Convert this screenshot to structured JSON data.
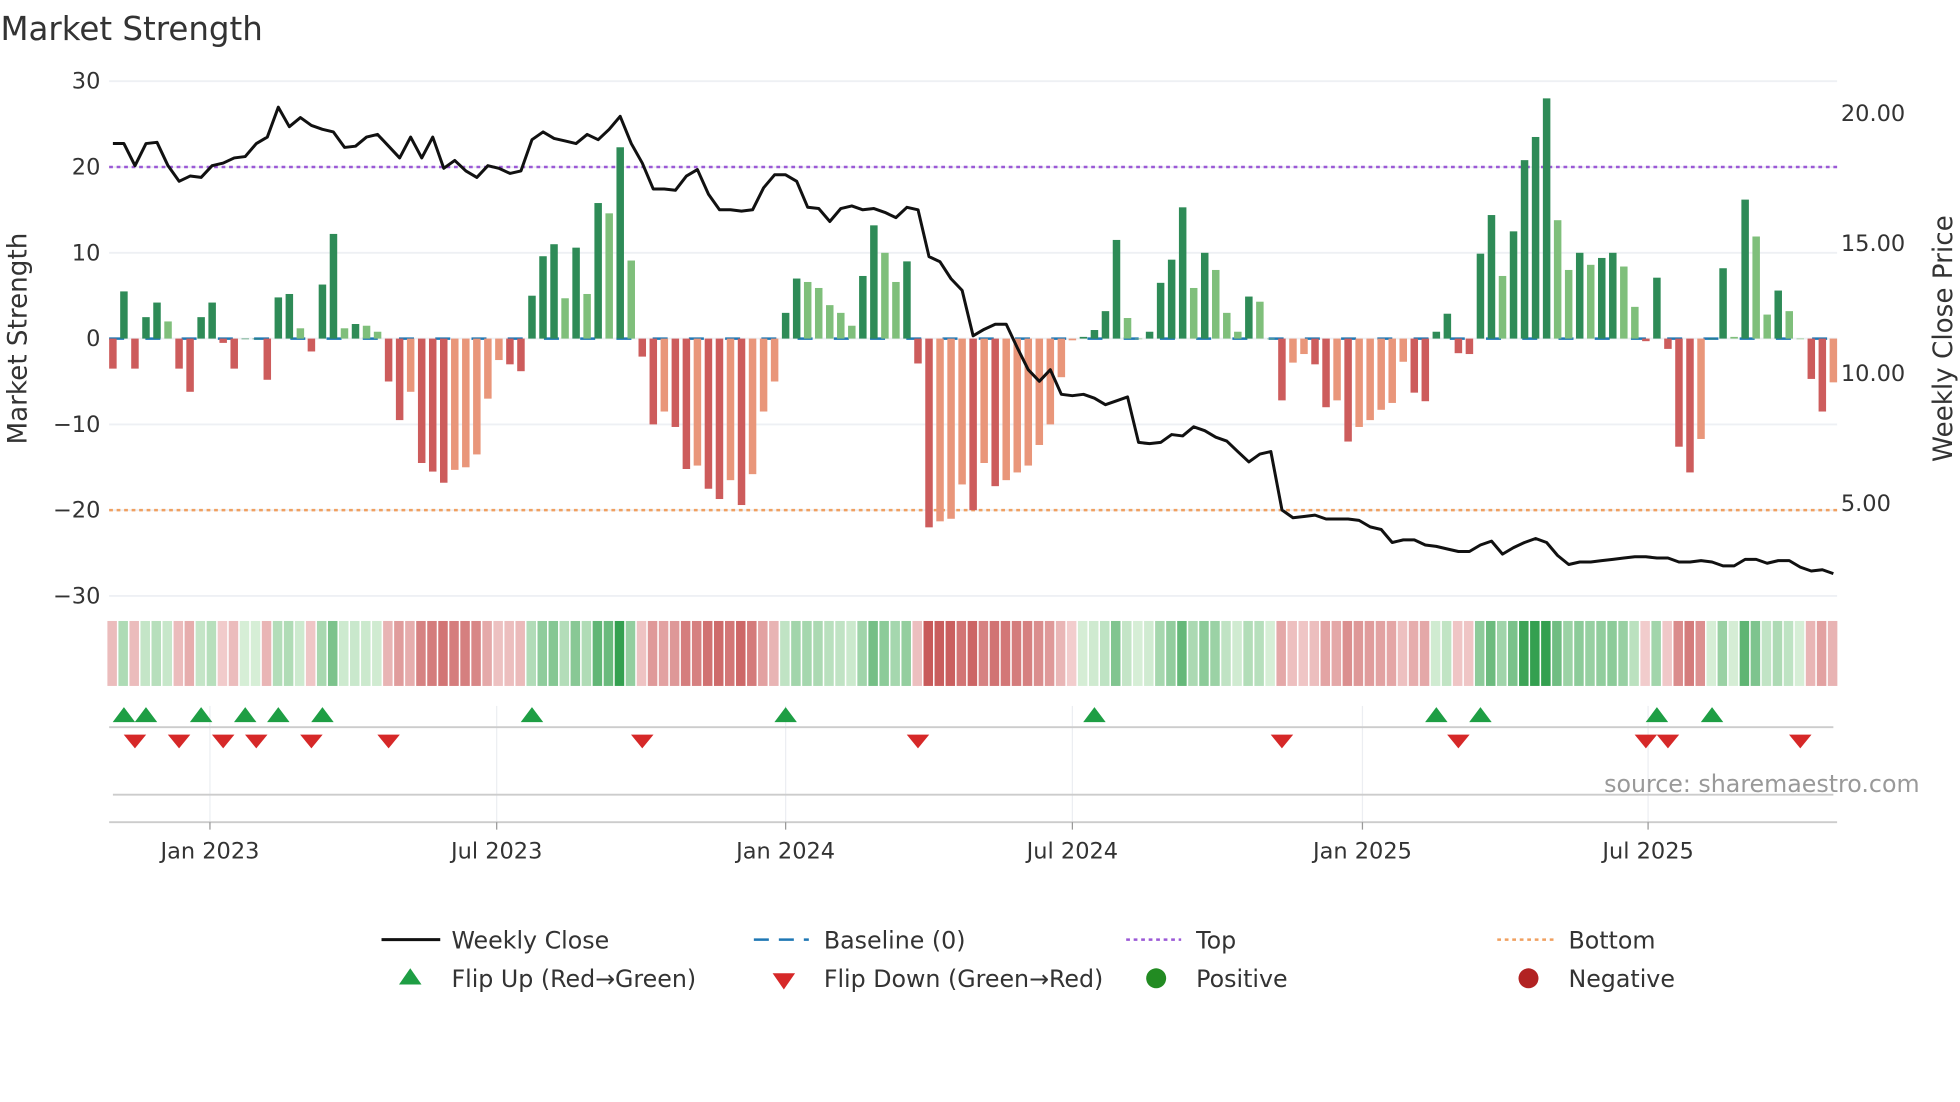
{
  "title": "Market Strength",
  "watermark": "source: sharemaestro.com",
  "chart_data": {
    "type": "bar",
    "title": "Market Strength",
    "ylabel": "Market Strength",
    "y2label": "Weekly Close Price",
    "ylim": [
      -30,
      30
    ],
    "y2lim": [
      1.44,
      21.25
    ],
    "frequency": "weekly",
    "yticks": [
      "30",
      "20",
      "10",
      "0",
      "−10",
      "−20",
      "−30"
    ],
    "ytick_values": [
      30,
      20,
      10,
      0,
      -10,
      -20,
      -30
    ],
    "y2ticks": [
      "20.00",
      "15.00",
      "10.00",
      "5.00"
    ],
    "y2tick_values": [
      20,
      15,
      10,
      5
    ],
    "xticks": [
      {
        "label": "Jan 2023",
        "week": 8.8
      },
      {
        "label": "Jul 2023",
        "week": 34.8
      },
      {
        "label": "Jan 2024",
        "week": 61.0
      },
      {
        "label": "Jul 2024",
        "week": 87.0
      },
      {
        "label": "Jan 2025",
        "week": 113.3
      },
      {
        "label": "Jul 2025",
        "week": 139.2
      }
    ],
    "top": 20,
    "bottom": -20,
    "baseline": 0,
    "strength": [
      -3.5,
      5.5,
      -3.5,
      2.5,
      4.2,
      2,
      -3.5,
      -6.2,
      2.5,
      4.2,
      -0.5,
      -3.5,
      0,
      0,
      -4.8,
      4.8,
      5.2,
      1.2,
      -1.5,
      6.3,
      12.2,
      1.2,
      1.7,
      1.5,
      0.8,
      -5,
      -9.5,
      -6.2,
      -14.5,
      -15.5,
      -16.8,
      -15.3,
      -15,
      -13.5,
      -7,
      -2.5,
      -3,
      -3.8,
      5,
      9.6,
      11,
      4.7,
      10.6,
      5.2,
      15.8,
      14.6,
      22.3,
      9.1,
      -2.1,
      -10,
      -8.5,
      -10.3,
      -15.2,
      -14.8,
      -17.5,
      -18.7,
      -16.5,
      -19.4,
      -15.8,
      -8.5,
      -5,
      3,
      7,
      6.6,
      5.9,
      3.9,
      3,
      1.5,
      7.3,
      13.2,
      10,
      6.6,
      9,
      -2.9,
      -22,
      -21.3,
      -21,
      -17,
      -20,
      -14.5,
      -17.2,
      -16.5,
      -15.6,
      -14.8,
      -12.4,
      -10,
      -4.5,
      -0.2,
      0.2,
      1,
      3.2,
      11.5,
      2.4,
      0,
      0.8,
      6.5,
      9.2,
      15.3,
      5.9,
      10,
      8,
      3,
      0.8,
      4.9,
      4.3,
      0,
      -7.2,
      -2.8,
      -1.8,
      -3,
      -8,
      -7.2,
      -12,
      -10.3,
      -9.5,
      -8.3,
      -7.5,
      -2.7,
      -6.3,
      -7.3,
      0.8,
      2.9,
      -1.7,
      -1.8,
      9.9,
      14.4,
      7.3,
      12.5,
      20.8,
      23.5,
      28,
      13.8,
      8,
      10,
      8.6,
      9.4,
      10,
      8.4,
      3.7,
      -0.3,
      7.1,
      -1.2,
      -12.6,
      -15.6,
      -11.7,
      0,
      8.2,
      0.2,
      16.2,
      11.9,
      2.8,
      5.6,
      3.2,
      0,
      -4.7,
      -8.5,
      -5.1
    ],
    "weekly_close": [
      18.85,
      18.85,
      18.0,
      18.85,
      18.9,
      18.0,
      17.4,
      17.6,
      17.55,
      18.0,
      18.1,
      18.3,
      18.35,
      18.85,
      19.1,
      20.25,
      19.5,
      19.85,
      19.55,
      19.4,
      19.3,
      18.7,
      18.75,
      19.1,
      19.2,
      18.75,
      18.3,
      19.1,
      18.3,
      19.1,
      17.9,
      18.2,
      17.8,
      17.55,
      18.0,
      17.9,
      17.7,
      17.8,
      19.0,
      19.3,
      19.05,
      18.95,
      18.85,
      19.2,
      19.0,
      19.4,
      19.9,
      18.85,
      18.1,
      17.1,
      17.1,
      17.05,
      17.6,
      17.85,
      16.9,
      16.3,
      16.3,
      16.25,
      16.3,
      17.15,
      17.65,
      17.65,
      17.4,
      16.4,
      16.35,
      15.85,
      16.35,
      16.45,
      16.3,
      16.35,
      16.2,
      16.0,
      16.4,
      16.3,
      14.5,
      14.3,
      13.65,
      13.2,
      11.45,
      11.7,
      11.9,
      11.9,
      11.0,
      10.15,
      9.7,
      10.15,
      9.2,
      9.15,
      9.2,
      9.05,
      8.8,
      8.95,
      9.1,
      7.35,
      7.3,
      7.35,
      7.65,
      7.6,
      7.95,
      7.8,
      7.55,
      7.4,
      7.0,
      6.6,
      6.9,
      7.0,
      4.75,
      4.45,
      4.5,
      4.55,
      4.4,
      4.4,
      4.4,
      4.35,
      4.1,
      4.0,
      3.5,
      3.6,
      3.6,
      3.4,
      3.35,
      3.25,
      3.15,
      3.15,
      3.4,
      3.55,
      3.05,
      3.3,
      3.5,
      3.65,
      3.5,
      3.0,
      2.65,
      2.75,
      2.75,
      2.8,
      2.85,
      2.9,
      2.95,
      2.95,
      2.9,
      2.9,
      2.75,
      2.75,
      2.8,
      2.75,
      2.6,
      2.6,
      2.85,
      2.85,
      2.7,
      2.8,
      2.8,
      2.55,
      2.4,
      2.45,
      2.3
    ],
    "flip_up_weeks": [
      1,
      3,
      8,
      12,
      15,
      19,
      38,
      61,
      89,
      120,
      124,
      140,
      145
    ],
    "flip_down_weeks": [
      2,
      6,
      10,
      13,
      18,
      25,
      48,
      73,
      106,
      122,
      139,
      141,
      153
    ],
    "legend": {
      "placement": "bottom",
      "weekly_close": "Weekly Close",
      "baseline": "Baseline (0)",
      "top": "Top",
      "bottom": "Bottom",
      "flip_up": "Flip Up (Red→Green)",
      "flip_down": "Flip Down (Green→Red)",
      "positive": "Positive",
      "negative": "Negative"
    },
    "colors": {
      "rising_positive": "#2e8b57",
      "falling_positive": "#7fbf7b",
      "falling_negative": "#cd5c5c",
      "rising_negative": "#e9967a",
      "baseline": "#1f77b4",
      "top": "#9b59d6",
      "bottom": "#f0a060",
      "close": "#111111",
      "flip_up": "#1e9e44",
      "flip_down": "#d62828",
      "positive": "#228b22",
      "negative": "#b22222"
    }
  }
}
